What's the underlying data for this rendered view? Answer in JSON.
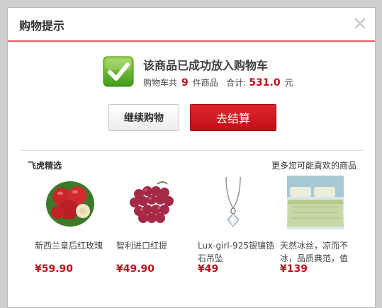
{
  "dialog": {
    "title": "购物提示",
    "message": "该商品已成功放入购物车",
    "summary": {
      "prefix": "购物车共",
      "count": "9",
      "count_suffix": "件商品",
      "total_label": "合计:",
      "total": "531.0",
      "currency": "元"
    },
    "buttons": {
      "continue": "继续购物",
      "checkout": "去结算"
    },
    "recommend": {
      "left_title": "飞虎精选",
      "right_title": "更多您可能喜欢的商品"
    },
    "products": [
      {
        "name": "新西兰皇后红玫瑰",
        "price": "¥59.90"
      },
      {
        "name": "智利进口红提",
        "price": "¥49.90"
      },
      {
        "name": "Lux-girl-925银镶锆石吊坠",
        "price": "¥49"
      },
      {
        "name": "天然冰丝，凉而不冰，品质典范，值",
        "price": "¥139"
      }
    ],
    "colors": {
      "accent_red": "#c10f1a",
      "header_line": "#e36464",
      "check_green": "#5fb32a"
    },
    "icons": [
      "close-icon",
      "check-icon"
    ]
  }
}
